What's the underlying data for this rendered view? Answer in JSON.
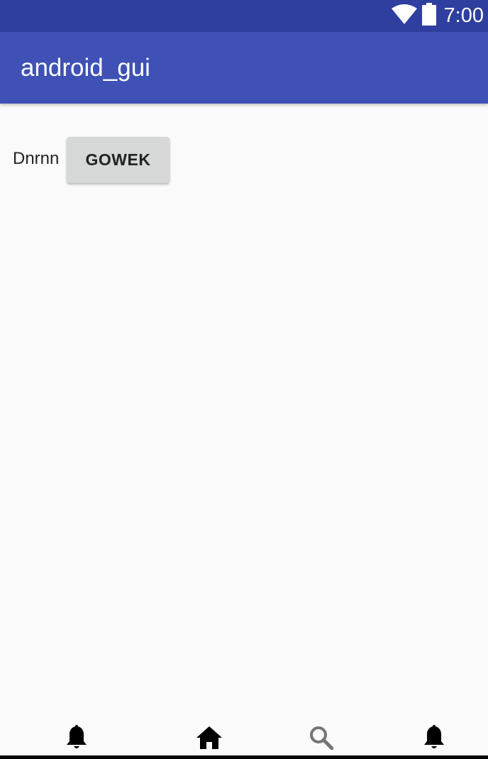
{
  "status_bar": {
    "time": "7:00",
    "icons": [
      "wifi-icon",
      "battery-icon"
    ],
    "color": "#2F3F9F"
  },
  "app_bar": {
    "title": "android_gui",
    "color": "#3F51B5"
  },
  "main": {
    "label": "Dnrnn",
    "button_label": "GOWEK"
  },
  "bottom_nav": {
    "items": [
      {
        "icon": "bell-icon"
      },
      {
        "icon": "home-icon"
      },
      {
        "icon": "search-icon"
      },
      {
        "icon": "bell-icon"
      }
    ]
  }
}
